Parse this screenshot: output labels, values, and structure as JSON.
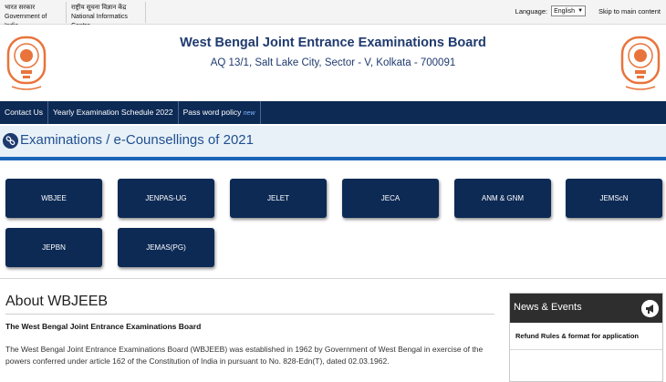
{
  "topbar": {
    "gov_hindi": "भारत सरकार",
    "gov_english": "Government of India",
    "nic_hindi": "राष्ट्रीय सूचना विज्ञान केंद्र",
    "nic_english": "National Informatics Centre",
    "language_label": "Language:",
    "language_selected": "English",
    "skip_link": "Skip to main content"
  },
  "header": {
    "title": "West Bengal Joint Entrance Examinations Board",
    "address": "AQ 13/1, Salt Lake City, Sector - V, Kolkata - 700091",
    "logo_icon": "wbjeeb-emblem-icon"
  },
  "nav": {
    "items": [
      {
        "label": "Contact Us"
      },
      {
        "label": "Yearly Examination Schedule 2022"
      },
      {
        "label": "Pass word policy",
        "badge": "new"
      }
    ]
  },
  "section": {
    "title": "Examinations / e-Counsellings of 2021",
    "icon": "link-icon"
  },
  "exams": [
    {
      "label": "WBJEE"
    },
    {
      "label": "JENPAS-UG"
    },
    {
      "label": "JELET"
    },
    {
      "label": "JECA"
    },
    {
      "label": "ANM & GNM"
    },
    {
      "label": "JEMScN"
    },
    {
      "label": "JEPBN"
    },
    {
      "label": "JEMAS(PG)"
    }
  ],
  "about": {
    "title": "About WBJEEB",
    "subtitle": "The West Bengal Joint Entrance Examinations Board",
    "text": "The West Bengal Joint Entrance Examinations Board (WBJEEB) was established in 1962 by Government of West Bengal in exercise of the powers conferred under article 162 of the Constitution of India in pursuant to No. 828-Edn(T), dated 02.03.1962."
  },
  "news": {
    "title": "News & Events",
    "icon": "megaphone-icon",
    "items": [
      {
        "label": "Refund Rules & format for application"
      }
    ]
  },
  "colors": {
    "navy": "#0d2a55",
    "title_blue": "#1f3a6e",
    "accent_blue": "#1a64b8",
    "logo_orange": "#e8743b"
  }
}
